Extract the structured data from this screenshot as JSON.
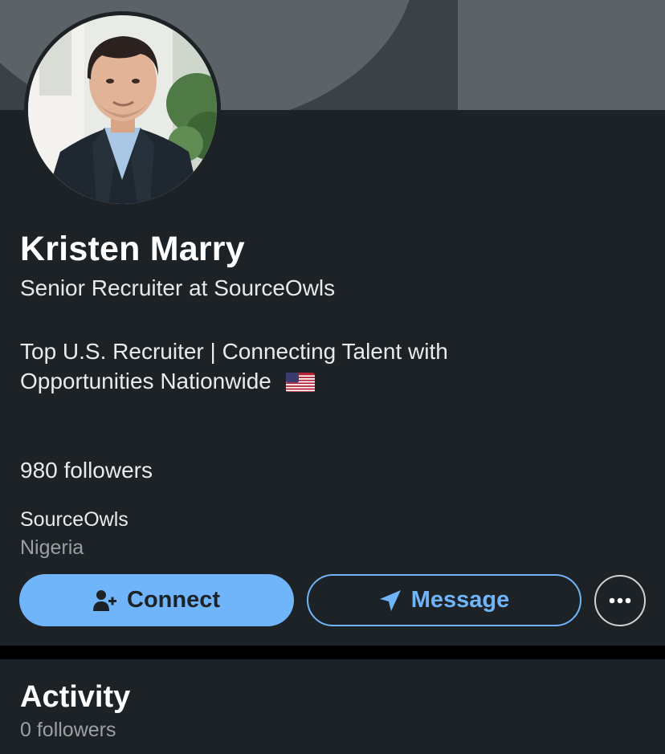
{
  "profile": {
    "name": "Kristen Marry",
    "headline": "Senior Recruiter at SourceOwls",
    "about": "Top U.S. Recruiter | Connecting Talent with Opportunities Nationwide",
    "about_flag": "flag-us-icon",
    "followers": "980 followers",
    "company": "SourceOwls",
    "location": "Nigeria"
  },
  "actions": {
    "connect_label": "Connect",
    "connect_icon": "add-person-icon",
    "message_label": "Message",
    "message_icon": "send-icon",
    "more_icon": "more-dots-icon"
  },
  "activity": {
    "title": "Activity",
    "followers": "0 followers"
  },
  "colors": {
    "background": "#1d2226",
    "accent": "#70b5f9",
    "muted_text": "#9aa0a4",
    "cover_gray": "#5b6366"
  }
}
